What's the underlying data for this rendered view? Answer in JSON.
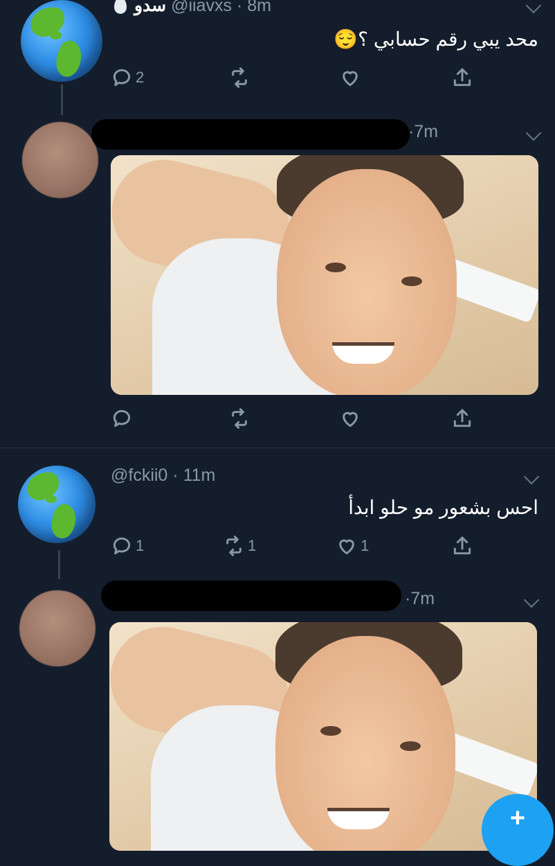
{
  "tweets": [
    {
      "name": "سدو",
      "handle": "@iiavxs",
      "time": "8m",
      "text": "محد يبي رقم حسابي ؟😌",
      "reply_count": "2",
      "retweet_count": "",
      "like_count": ""
    },
    {
      "name": "",
      "handle": "",
      "time": "7m",
      "text": "",
      "reply_count": "",
      "retweet_count": "",
      "like_count": ""
    },
    {
      "name": "",
      "handle": "@fckii0",
      "time": "11m",
      "text": "احس بشعور مو حلو ابدأ",
      "reply_count": "1",
      "retweet_count": "1",
      "like_count": "1"
    },
    {
      "name": "",
      "handle": "",
      "time": "7m",
      "text": "",
      "reply_count": "",
      "retweet_count": "",
      "like_count": ""
    }
  ],
  "separator": "·",
  "fab": {
    "label": "+"
  },
  "icons": {
    "reply": "reply-icon",
    "retweet": "retweet-icon",
    "like": "heart-icon",
    "share": "share-icon",
    "more": "chevron-down-icon",
    "compose": "compose-tweet-icon"
  },
  "colors": {
    "background": "#141d2b",
    "accent": "#1da1f2",
    "muted": "#8899a6"
  }
}
